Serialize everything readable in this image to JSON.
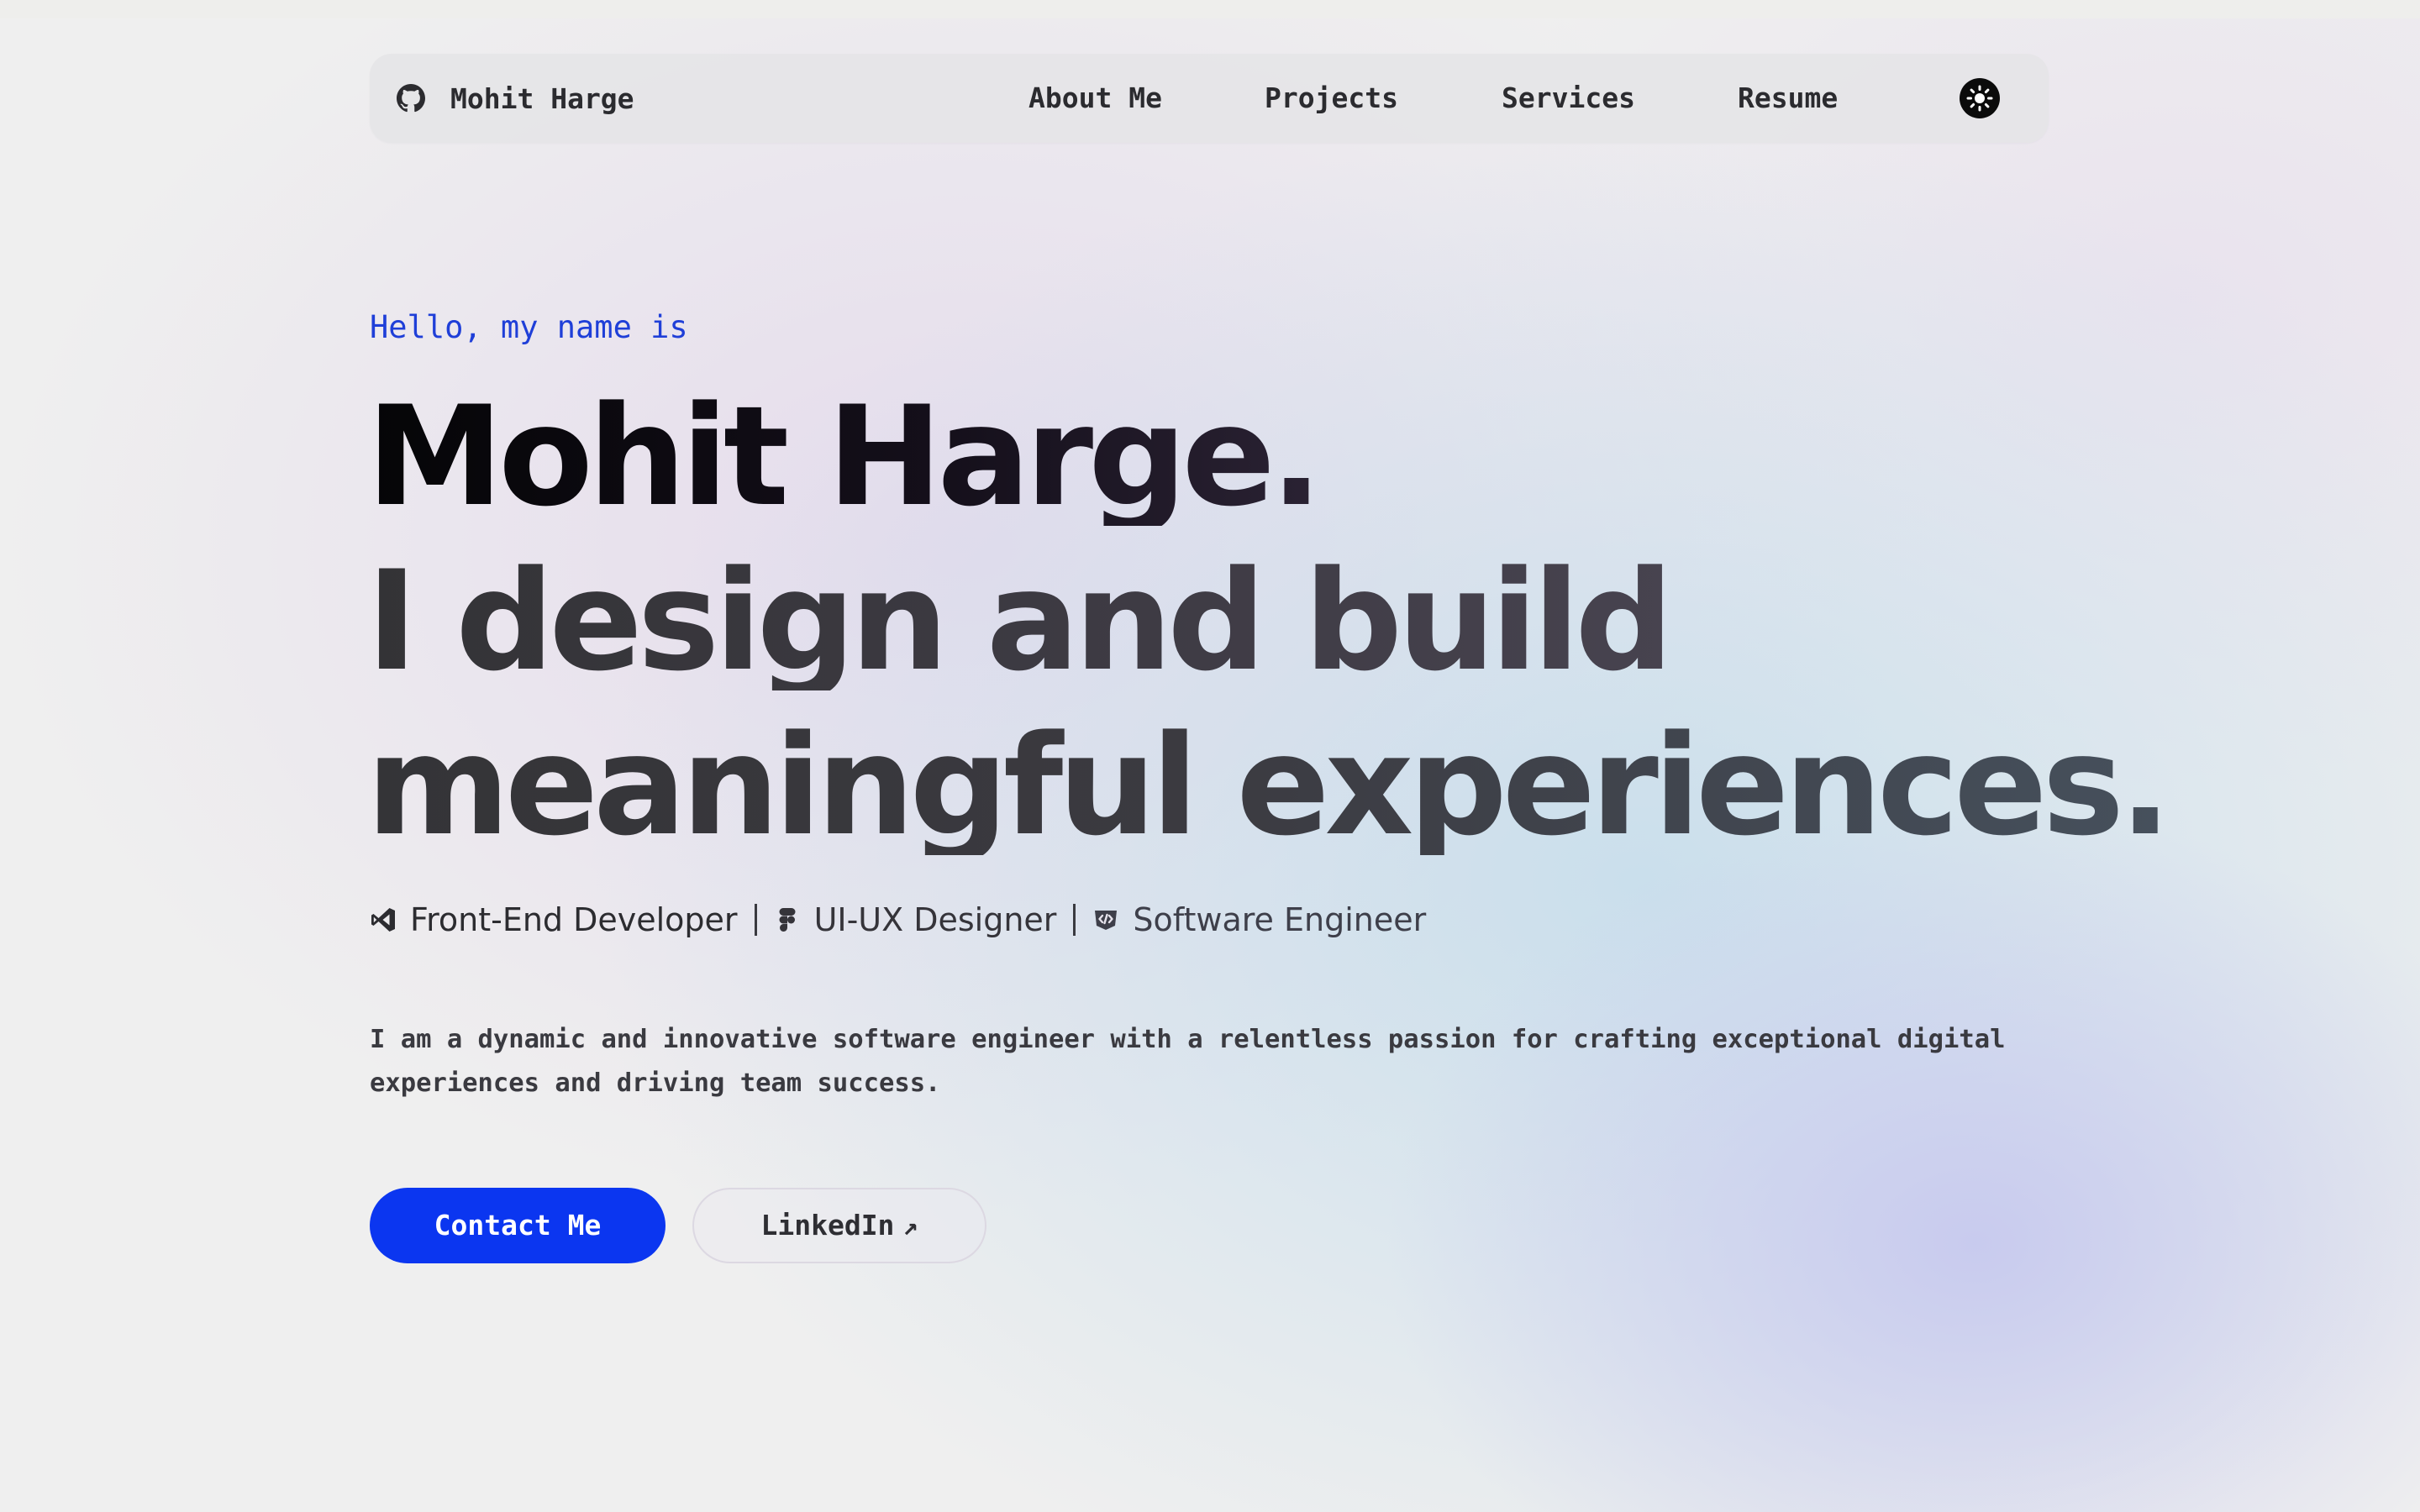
{
  "nav": {
    "brand": {
      "icon": "github-icon",
      "label": "Mohit Harge"
    },
    "links": [
      {
        "label": "About Me"
      },
      {
        "label": "Projects"
      },
      {
        "label": "Services"
      },
      {
        "label": "Resume"
      }
    ],
    "theme_toggle": {
      "icon": "sun-icon"
    }
  },
  "hero": {
    "greeting": "Hello, my name is",
    "name": "Mohit Harge.",
    "tagline_line1": "I design and build",
    "tagline_line2": "meaningful experiences.",
    "roles": [
      {
        "icon": "vscode-icon",
        "label": "Front-End Developer"
      },
      {
        "icon": "figma-icon",
        "label": "UI-UX Designer"
      },
      {
        "icon": "code-shield-icon",
        "label": "Software Engineer"
      }
    ],
    "bio": "I am a dynamic and innovative software engineer with a relentless passion for crafting exceptional digital experiences and driving team success.",
    "primary_button": {
      "label": "Contact Me"
    },
    "secondary_button": {
      "label": "LinkedIn",
      "icon": "external-arrow-icon",
      "arrow": "↗"
    }
  },
  "colors": {
    "accent": "#0b36f0",
    "greeting": "#1f3fd8",
    "heading": "#050507",
    "text": "#2b2b2f"
  }
}
